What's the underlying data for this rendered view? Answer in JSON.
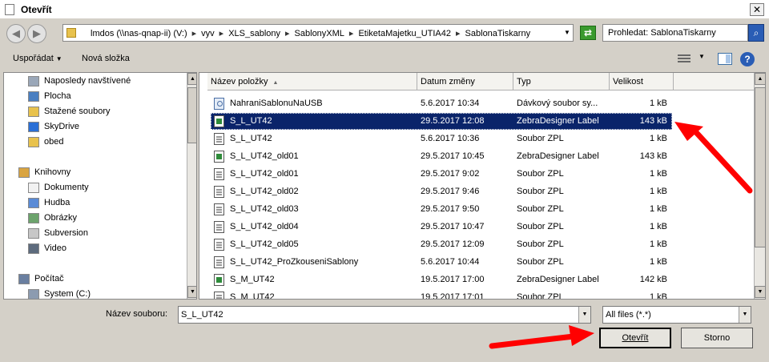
{
  "window": {
    "title": "Otevřít",
    "close_symbol": "✕"
  },
  "address": {
    "back_symbol": "◀",
    "forward_symbol": "▶",
    "crumbs": [
      "lmdos (\\\\nas-qnap-ii) (V:)",
      "vyv",
      "XLS_sablony",
      "SablonyXML",
      "EtiketaMajetku_UTIA42",
      "SablonaTiskarny"
    ],
    "crumb_separator": "▸",
    "dropdown_symbol": "▼",
    "refresh_symbol": "⇄",
    "search_placeholder": "Prohledat: SablonaTiskarny",
    "search_symbol": "⌕"
  },
  "toolbar": {
    "organize": "Uspořádat",
    "organize_arrow": "▼",
    "new_folder": "Nová složka",
    "view_dd": "▼",
    "help": "?"
  },
  "nav": {
    "items": [
      {
        "label": "Naposledy navštívené",
        "icon": "recent-places-icon",
        "color": "#9aa7b8"
      },
      {
        "label": "Plocha",
        "icon": "desktop-icon",
        "color": "#4a7fc1"
      },
      {
        "label": "Stažené soubory",
        "icon": "downloads-folder-icon",
        "color": "#e8c24d"
      },
      {
        "label": "SkyDrive",
        "icon": "cloud-icon",
        "color": "#2a6fd6"
      },
      {
        "label": "obed",
        "icon": "folder-icon",
        "color": "#e8c24d"
      },
      {
        "label": "Knihovny",
        "icon": "libraries-icon",
        "color": "#d9a441"
      },
      {
        "label": "Dokumenty",
        "icon": "documents-icon",
        "color": "#f2f2f2"
      },
      {
        "label": "Hudba",
        "icon": "music-icon",
        "color": "#5a8bd6"
      },
      {
        "label": "Obrázky",
        "icon": "pictures-icon",
        "color": "#6ca36c"
      },
      {
        "label": "Subversion",
        "icon": "subversion-icon",
        "color": "#c7c7c7"
      },
      {
        "label": "Video",
        "icon": "video-icon",
        "color": "#5d6b7d"
      },
      {
        "label": "Počítač",
        "icon": "computer-icon",
        "color": "#6a7fa0"
      },
      {
        "label": "System (C:)",
        "icon": "drive-icon",
        "color": "#8c9bb0"
      }
    ]
  },
  "scroll": {
    "up": "▲",
    "down": "▼"
  },
  "columns": {
    "name": "Název položky",
    "sort_indicator": "▲",
    "date": "Datum změny",
    "type": "Typ",
    "size": "Velikost"
  },
  "files": [
    {
      "name": "NahraniSablonuNaUSB",
      "date": "5.6.2017 10:34",
      "type": "Dávkový soubor sy...",
      "size": "1 kB",
      "kind": "bat"
    },
    {
      "name": "S_L_UT42",
      "date": "29.5.2017 12:08",
      "type": "ZebraDesigner Label",
      "size": "143 kB",
      "kind": "label",
      "selected": true
    },
    {
      "name": "S_L_UT42",
      "date": "5.6.2017 10:36",
      "type": "Soubor ZPL",
      "size": "1 kB",
      "kind": "zpl"
    },
    {
      "name": "S_L_UT42_old01",
      "date": "29.5.2017 10:45",
      "type": "ZebraDesigner Label",
      "size": "143 kB",
      "kind": "label"
    },
    {
      "name": "S_L_UT42_old01",
      "date": "29.5.2017 9:02",
      "type": "Soubor ZPL",
      "size": "1 kB",
      "kind": "zpl"
    },
    {
      "name": "S_L_UT42_old02",
      "date": "29.5.2017 9:46",
      "type": "Soubor ZPL",
      "size": "1 kB",
      "kind": "zpl"
    },
    {
      "name": "S_L_UT42_old03",
      "date": "29.5.2017 9:50",
      "type": "Soubor ZPL",
      "size": "1 kB",
      "kind": "zpl"
    },
    {
      "name": "S_L_UT42_old04",
      "date": "29.5.2017 10:47",
      "type": "Soubor ZPL",
      "size": "1 kB",
      "kind": "zpl"
    },
    {
      "name": "S_L_UT42_old05",
      "date": "29.5.2017 12:09",
      "type": "Soubor ZPL",
      "size": "1 kB",
      "kind": "zpl"
    },
    {
      "name": "S_L_UT42_ProZkouseniSablony",
      "date": "5.6.2017 10:44",
      "type": "Soubor ZPL",
      "size": "1 kB",
      "kind": "zpl"
    },
    {
      "name": "S_M_UT42",
      "date": "19.5.2017 17:00",
      "type": "ZebraDesigner Label",
      "size": "142 kB",
      "kind": "label"
    },
    {
      "name": "S_M_UT42",
      "date": "19.5.2017 17:01",
      "type": "Soubor ZPL",
      "size": "1 kB",
      "kind": "zpl"
    }
  ],
  "bottom": {
    "filename_label": "Název souboru:",
    "filename_value": "S_L_UT42",
    "dropdown_symbol": "▼",
    "filetype_value": "All files (*.*)",
    "open_button": "Otevřít",
    "cancel_button": "Storno"
  },
  "annotation_color": "#ff0000"
}
